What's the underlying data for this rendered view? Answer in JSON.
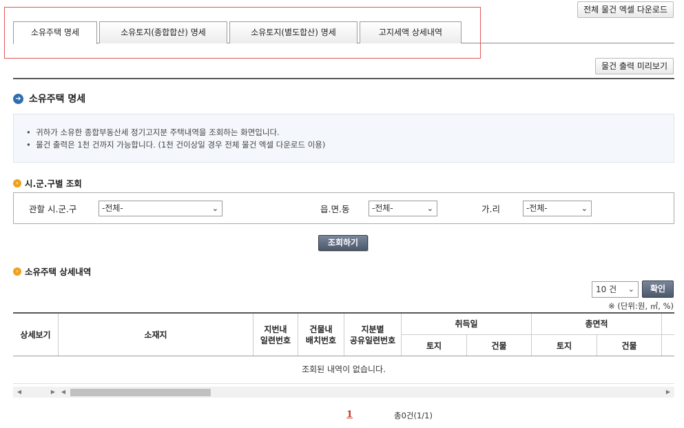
{
  "top_actions": {
    "excel_download": "전체 물건 엑셀 다운로드"
  },
  "tabs": [
    {
      "label": "소유주택 명세",
      "active": true
    },
    {
      "label": "소유토지(종합합산) 명세",
      "active": false
    },
    {
      "label": "소유토지(별도합산) 명세",
      "active": false
    },
    {
      "label": "고지세액 상세내역",
      "active": false
    }
  ],
  "preview_button": "물건 출력 미리보기",
  "section": {
    "title": "소유주택 명세",
    "notices": [
      "귀하가 소유한 종합부동산세 정기고지분 주택내역을 조회하는 화면입니다.",
      "물건 출력은 1천 건까지 가능합니다. (1천 건이상일 경우 전체 물건 엑셀 다운로드 이용)"
    ]
  },
  "filter": {
    "title": "시.군.구별 조회",
    "sigungu": {
      "label": "관할 시.군.구",
      "value": "-전체-"
    },
    "eupmyeondong": {
      "label": "읍.면.동",
      "value": "-전체-"
    },
    "gari": {
      "label": "가.리",
      "value": "-전체-"
    },
    "search_button": "조회하기"
  },
  "details": {
    "title": "소유주택 상세내역",
    "page_size": "10 건",
    "confirm_button": "확인",
    "unit_note": "※ (단위:원, ㎡, %)",
    "columns": {
      "view": "상세보기",
      "location": "소재지",
      "lot_serial": "지번내\n일련번호",
      "building_serial": "건물내\n배치번호",
      "share_serial": "지분별\n공유일련번호",
      "acq_date": "취득일",
      "acq_land": "토지",
      "acq_building": "건물",
      "total_area": "총면적",
      "area_land": "토지",
      "area_building": "건물"
    },
    "empty_message": "조회된 내역이 없습니다."
  },
  "pagination": {
    "current_page": "1",
    "total": "총0건(1/1)"
  }
}
